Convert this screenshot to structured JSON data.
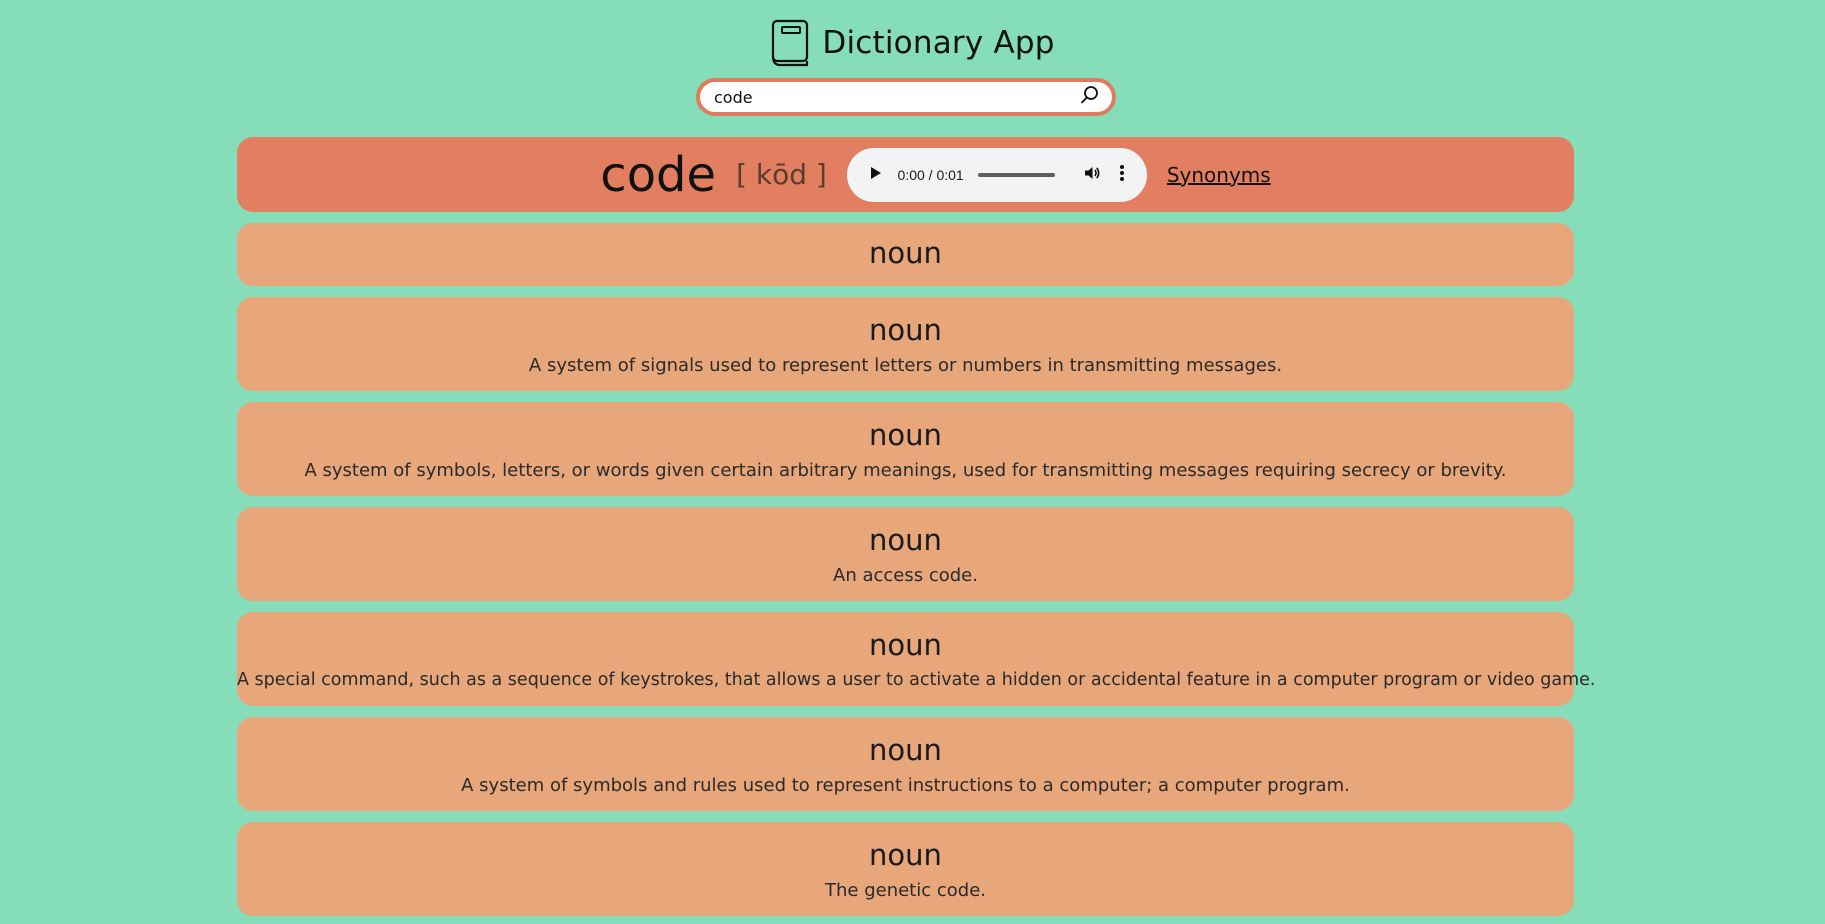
{
  "app": {
    "title": "Dictionary App",
    "icon": "book-icon"
  },
  "search": {
    "value": "code",
    "placeholder": "",
    "icon": "search-icon"
  },
  "word": {
    "text": "code",
    "phonetic": "[ kōd ]",
    "synonyms_label": "Synonyms"
  },
  "audio": {
    "time": "0:00 / 0:01",
    "progress": 0
  },
  "meanings": [
    {
      "part_of_speech": "noun",
      "definition": ""
    },
    {
      "part_of_speech": "noun",
      "definition": "A system of signals used to represent letters or numbers in transmitting messages."
    },
    {
      "part_of_speech": "noun",
      "definition": "A system of symbols, letters, or words given certain arbitrary meanings, used for transmitting messages requiring secrecy or brevity."
    },
    {
      "part_of_speech": "noun",
      "definition": "An access code."
    },
    {
      "part_of_speech": "noun",
      "definition": "A special command, such as a sequence of keystrokes, that allows a user to activate a hidden or accidental feature in a computer program or video game."
    },
    {
      "part_of_speech": "noun",
      "definition": "A system of symbols and rules used to represent instructions to a computer; a computer program."
    },
    {
      "part_of_speech": "noun",
      "definition": "The genetic code."
    }
  ],
  "colors": {
    "background": "#85ddb9",
    "word_bar": "#e27f61",
    "card": "#e8a67b",
    "search_border": "#e07b5f"
  }
}
